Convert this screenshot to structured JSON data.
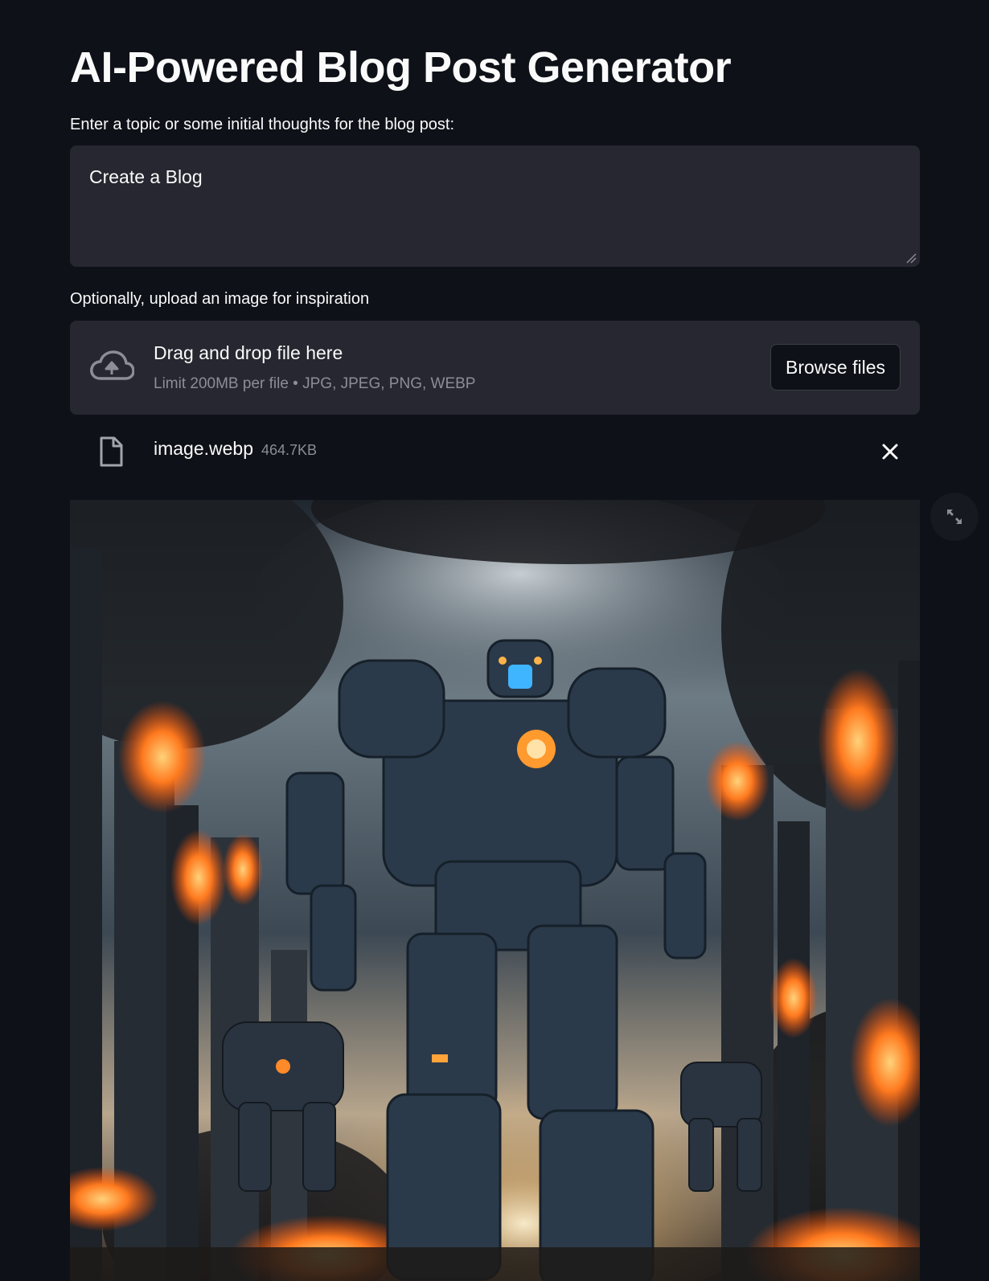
{
  "header": {
    "title": "AI-Powered Blog Post Generator"
  },
  "topic_input": {
    "label": "Enter a topic or some initial thoughts for the blog post:",
    "value": "Create a Blog"
  },
  "uploader": {
    "label": "Optionally, upload an image for inspiration",
    "drop_title": "Drag and drop file here",
    "drop_subtitle": "Limit 200MB per file • JPG, JPEG, PNG, WEBP",
    "browse_label": "Browse files",
    "icon": "cloud-upload-icon"
  },
  "uploaded_file": {
    "name": "image.webp",
    "size": "464.7KB",
    "icon": "file-icon"
  },
  "preview_image": {
    "description_icon": "fullscreen-icon"
  },
  "colors": {
    "background": "#0e1117",
    "surface": "#262730",
    "text": "#fafafa",
    "muted": "#8b8d98"
  }
}
